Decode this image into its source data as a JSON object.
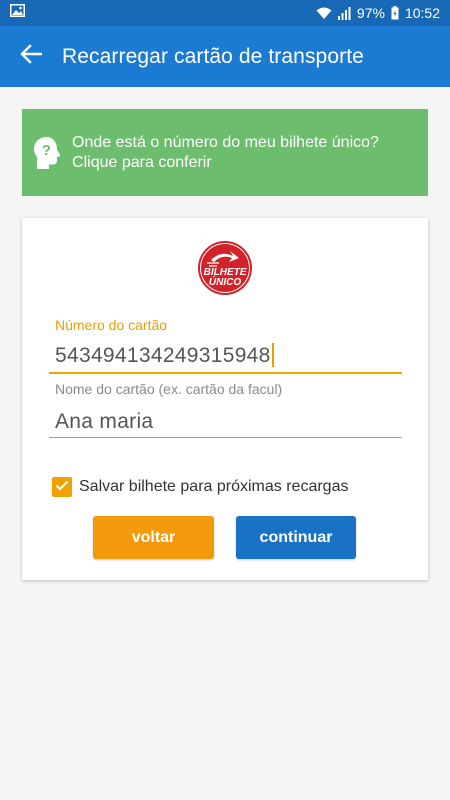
{
  "status_bar": {
    "battery": "97%",
    "time": "10:52",
    "icons": [
      "image-icon",
      "wifi-icon",
      "signal-icon",
      "battery-icon"
    ]
  },
  "app_bar": {
    "title": "Recarregar cartão de transporte",
    "back_icon": "arrow-back-icon"
  },
  "help_banner": {
    "text": "Onde está o número do meu bilhete único? Clique para conferir",
    "icon": "head-question-icon",
    "color": "#6cbd6e"
  },
  "card": {
    "logo": {
      "line1": "BILHETE",
      "line2": "ÚNICO",
      "color": "#d3222a"
    },
    "card_number": {
      "label": "Número do cartão",
      "value": "543494134249315948"
    },
    "card_name": {
      "label": "Nome do cartão (ex. cartão da facul)",
      "value": "Ana maria"
    },
    "save_checkbox": {
      "label": "Salvar bilhete para próximas recargas",
      "checked": true
    },
    "buttons": {
      "back": "voltar",
      "continue": "continuar"
    }
  },
  "colors": {
    "status_bar": "#1769b6",
    "app_bar": "#1b7bd3",
    "accent": "#f39a0c",
    "primary_button": "#1a72c4"
  }
}
